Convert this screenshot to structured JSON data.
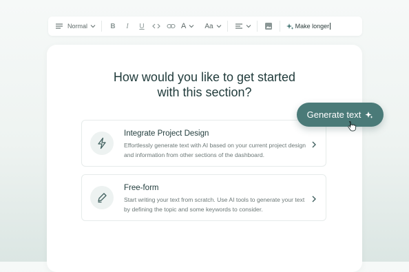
{
  "toolbar": {
    "style_label": "Normal",
    "bold_label": "B",
    "italic_label": "I",
    "underline_label": "U",
    "font_color_label": "A",
    "font_size_label": "Aa",
    "ai_input_value": "Make longer"
  },
  "main": {
    "title_line1": "How would you like to get started",
    "title_line2": "with this section?",
    "options": [
      {
        "title": "Integrate Project Design",
        "description": "Effortlessly generate text with AI based on your current project design and information from other sections of the dashboard.",
        "icon": "lightning-icon"
      },
      {
        "title": "Free-form",
        "description": "Start writing your text from scratch. Use AI tools to generate your text by defining the topic and some keywords to consider.",
        "icon": "pen-icon"
      }
    ]
  },
  "generate_button": {
    "label": "Generate text",
    "icon": "sparkle-icon"
  },
  "colors": {
    "accent": "#4a7a78",
    "title": "#1f3a3a",
    "panel": "#ffffff"
  }
}
